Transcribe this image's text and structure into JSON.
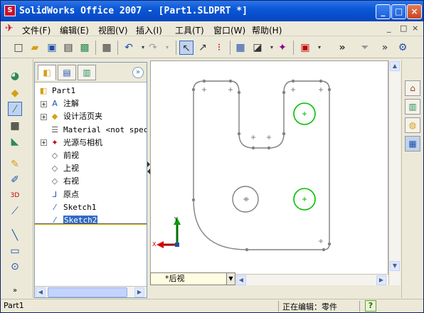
{
  "window": {
    "title": "SolidWorks Office 2007 - [Part1.SLDPRT *]",
    "app_icon": "sw",
    "minimize": "_",
    "maximize": "□",
    "close": "×"
  },
  "menu": {
    "items": [
      "文件(F)",
      "编辑(E)",
      "视图(V)",
      "插入(I)",
      "工具(T)",
      "窗口(W)",
      "帮助(H)"
    ],
    "win_controls": [
      "_",
      "□",
      "×"
    ]
  },
  "toolbar": {
    "more": "»"
  },
  "feature_manager": {
    "tabs": [
      "feature-tree-tab",
      "property-manager-tab",
      "configuration-manager-tab"
    ],
    "collapse": "»",
    "tree": [
      {
        "label": "Part1",
        "icon": "part-icon",
        "expander": "",
        "indent": 0
      },
      {
        "label": "注解",
        "icon": "annotations-icon",
        "expander": "+",
        "indent": 1
      },
      {
        "label": "设计活页夹",
        "icon": "design-binder-icon",
        "expander": "+",
        "indent": 1
      },
      {
        "label": "Material <not speci",
        "icon": "material-icon",
        "expander": "",
        "indent": 1
      },
      {
        "label": "光源与相机",
        "icon": "lights-cameras-icon",
        "expander": "+",
        "indent": 1
      },
      {
        "label": "前视",
        "icon": "plane-icon",
        "expander": "",
        "indent": 1
      },
      {
        "label": "上视",
        "icon": "plane-icon",
        "expander": "",
        "indent": 1
      },
      {
        "label": "右视",
        "icon": "plane-icon",
        "expander": "",
        "indent": 1
      },
      {
        "label": "原点",
        "icon": "origin-icon",
        "expander": "",
        "indent": 1
      },
      {
        "label": "Sketch1",
        "icon": "sketch-icon",
        "expander": "",
        "indent": 1
      },
      {
        "label": "Sketch2",
        "icon": "sketch-icon",
        "expander": "",
        "indent": 1,
        "selected": true
      }
    ]
  },
  "canvas": {
    "view_name": "*后视",
    "triad": {
      "y": "Y",
      "x": "X"
    }
  },
  "statusbar": {
    "left": "Part1",
    "mode": "正在编辑：零件",
    "help": "?"
  },
  "colors": {
    "title_bar": "#0A58D6",
    "selection": "#316AC5",
    "sketch_line": "#808080",
    "circle_green": "#00C000",
    "rollback_bar": "#E8C800"
  }
}
